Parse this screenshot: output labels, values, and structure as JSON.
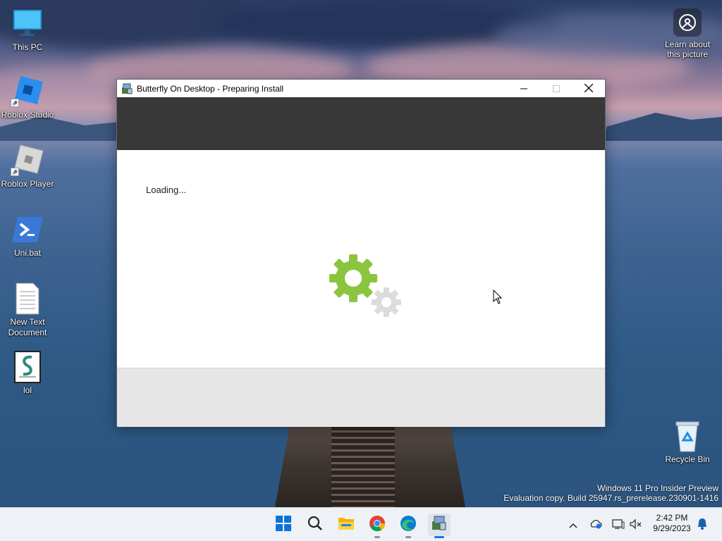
{
  "desktop": {
    "icons": [
      {
        "label": "This PC"
      },
      {
        "label": "Roblox Studio"
      },
      {
        "label": "Roblox Player"
      },
      {
        "label": "Uni.bat"
      },
      {
        "label": "New Text Document"
      },
      {
        "label": "lol"
      }
    ],
    "learn_label": "Learn about this picture",
    "recycle_label": "Recycle Bin",
    "watermark_line1": "Windows 11 Pro Insider Preview",
    "watermark_line2": "Evaluation copy. Build 25947.rs_prerelease.230901-1416"
  },
  "window": {
    "title": "Butterfly On Desktop - Preparing Install",
    "status_text": "Loading...",
    "minimize_icon": "minimize-icon",
    "maximize_icon": "maximize-icon",
    "close_icon": "close-icon",
    "banner_color": "#383838",
    "gear_color": "#8bc53f"
  },
  "taskbar": {
    "apps": [
      "start-icon",
      "search-icon",
      "file-explorer-icon",
      "chrome-icon",
      "edge-icon",
      "installer-icon"
    ],
    "time": "2:42 PM",
    "date": "9/29/2023"
  }
}
